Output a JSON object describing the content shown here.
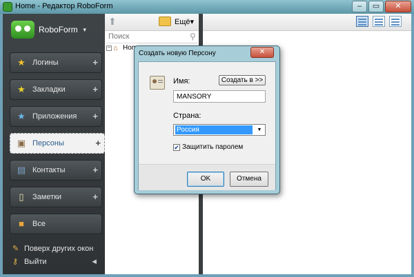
{
  "window": {
    "title": "Home - Редактор RoboForm",
    "controls": {
      "minimize": "–",
      "maximize": "▭",
      "close": "✕"
    }
  },
  "sidebar": {
    "brand": "RoboForm",
    "items": [
      {
        "label": "Логины",
        "icon": "star-logins-icon"
      },
      {
        "label": "Закладки",
        "icon": "star-bookmarks-icon"
      },
      {
        "label": "Приложения",
        "icon": "star-apps-icon"
      },
      {
        "label": "Персоны",
        "icon": "identity-card-icon",
        "active": true
      },
      {
        "label": "Контакты",
        "icon": "contacts-icon"
      },
      {
        "label": "Заметки",
        "icon": "notes-icon"
      },
      {
        "label": "Все",
        "icon": "briefcase-icon"
      }
    ],
    "plus": "+",
    "bottom": {
      "topmost": "Поверх других окон",
      "exit": "Выйти",
      "collapse_arrow": "◄"
    }
  },
  "middle": {
    "more_label": "Ещё▾",
    "search_placeholder": "Поиск",
    "tree_root": "Home",
    "tree_expander": "−"
  },
  "dialog": {
    "title": "Создать новую Персону",
    "close": "✕",
    "name_label": "Имя:",
    "create_in_button": "Создать в >>",
    "name_value": "MANSORY",
    "country_label": "Страна:",
    "country_value": "Россия",
    "select_arrow": "▼",
    "protect_label": "Защитить паролем",
    "protect_checked": "☑",
    "ok_button": "OK",
    "cancel_button": "Отмена"
  },
  "colors": {
    "accent": "#3399ff",
    "sidebar_bg": "#3a3f42",
    "close_red": "#c7503a"
  }
}
